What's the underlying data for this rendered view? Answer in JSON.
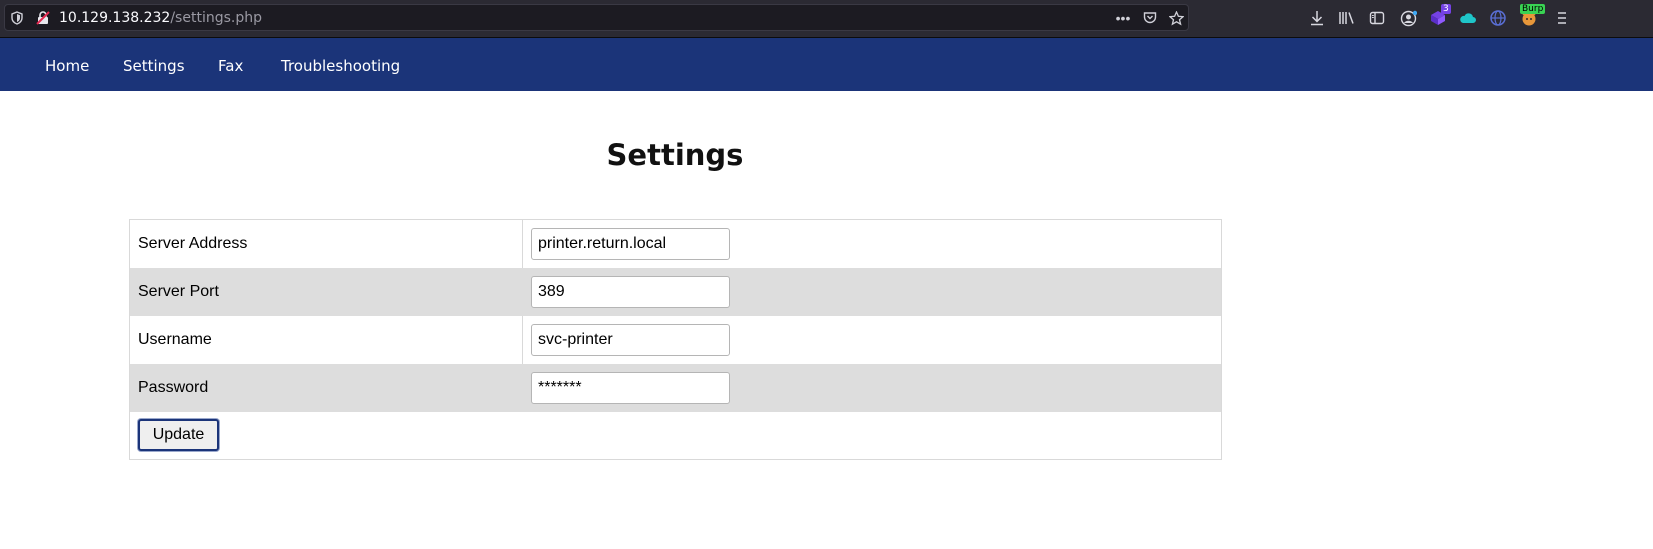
{
  "browser": {
    "url_host": "10.129.138.232",
    "url_path": "/settings.php",
    "extension_badge_count": "3",
    "burp_badge": "Burp",
    "more_glyph": "•••"
  },
  "nav": {
    "items": [
      {
        "label": "Home"
      },
      {
        "label": "Settings"
      },
      {
        "label": "Fax"
      },
      {
        "label": "Troubleshooting"
      }
    ]
  },
  "page": {
    "title": "Settings"
  },
  "form": {
    "rows": [
      {
        "label": "Server Address",
        "value": "printer.return.local"
      },
      {
        "label": "Server Port",
        "value": "389"
      },
      {
        "label": "Username",
        "value": "svc-printer"
      },
      {
        "label": "Password",
        "value": "*******"
      }
    ],
    "submit_label": "Update"
  },
  "colors": {
    "nav_background": "#1b3479",
    "row_shade": "#dddddd",
    "browser_chrome": "#2b2a33"
  }
}
